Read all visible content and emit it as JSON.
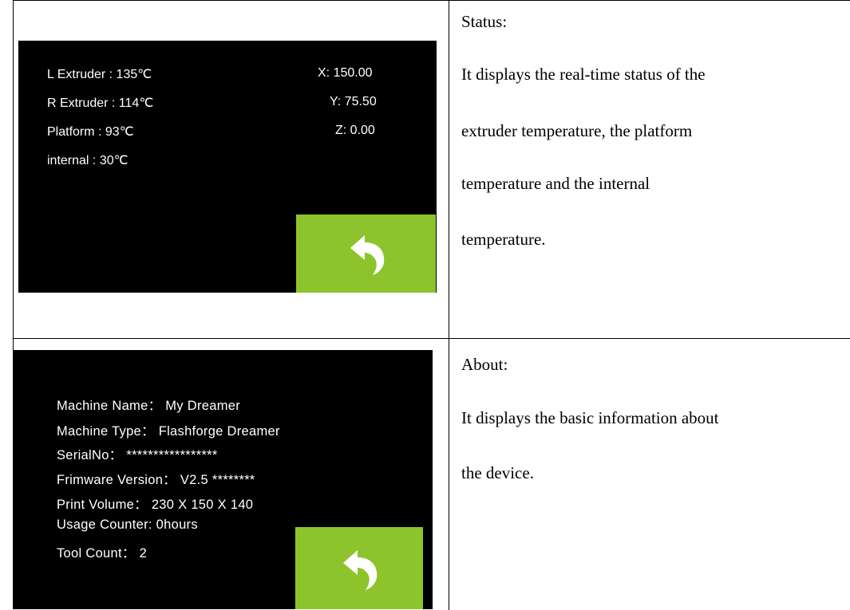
{
  "status_screen": {
    "left_lines": [
      "L Extruder : 135℃",
      "R Extruder : 114℃",
      "Platform : 93℃",
      "internal : 30℃"
    ],
    "right_lines": [
      "X: 150.00",
      "Y: 75.50",
      "Z: 0.00"
    ],
    "back_icon": "return-arrow-icon",
    "button_color": "#8dc42b"
  },
  "status_desc": {
    "title": "Status:",
    "lines": [
      "It displays the real-time status of the",
      "extruder temperature, the platform",
      "temperature and the internal",
      "temperature."
    ]
  },
  "about_screen": {
    "lines": [
      "Machine Name： My Dreamer",
      "Machine Type： Flashforge Dreamer",
      "SerialNo： *****************",
      "Frimware Version： V2.5 ********",
      "Print Volume： 230 X 150 X 140",
      "Usage Counter: 0hours",
      "Tool Count： 2"
    ],
    "back_icon": "return-arrow-icon",
    "button_color": "#8dc42b"
  },
  "about_desc": {
    "title": "About:",
    "lines": [
      "It displays the basic information about",
      "the device."
    ]
  }
}
